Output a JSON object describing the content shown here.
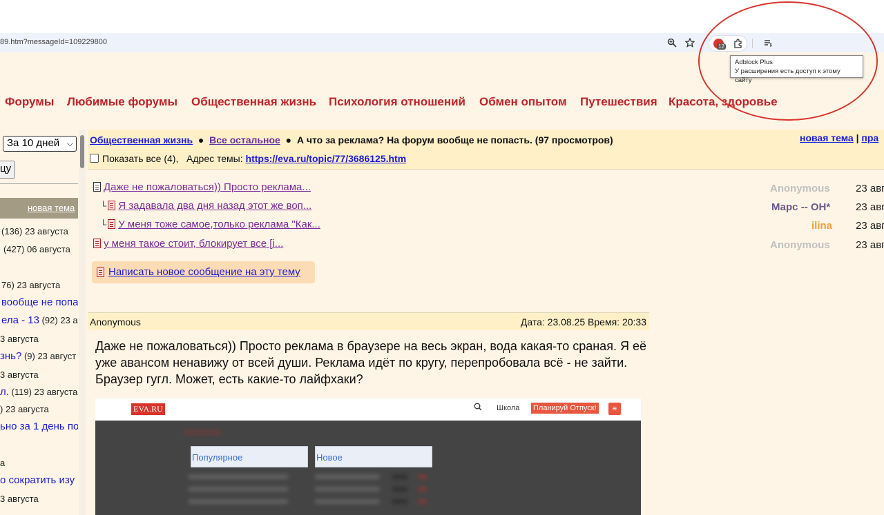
{
  "browser": {
    "url": "89.htm?messageId=109229800",
    "tooltip": {
      "title": "Adblock Plus",
      "text": "У расширения есть доступ к этому сайту"
    },
    "extension_badge": "12"
  },
  "nav": {
    "items": [
      "Форумы",
      "Любимые форумы",
      "Общественная жизнь",
      "Психология отношений",
      "Обмен опытом",
      "Путешествия",
      "Красота, здоровье"
    ]
  },
  "left": {
    "period_select": "За 10 дней",
    "button_label": "цу",
    "new_topic": "новая тема",
    "rows": [
      {
        "pre": "(136) 23 августа",
        "link": ""
      },
      {
        "pre": "(427) 06 августа",
        "link": ""
      },
      {
        "pre": "76) 23 августа",
        "link": ""
      },
      {
        "pre": "",
        "link": "вообще не попа"
      },
      {
        "pre": "(92) 23 а",
        "link": "ела - 13"
      },
      {
        "pre": "3 августа",
        "link": ""
      },
      {
        "pre": "(9) 23 август",
        "link": "знь?"
      },
      {
        "pre": "3 августа",
        "link": ""
      },
      {
        "pre": "(119) 23 августа",
        "link": "л."
      },
      {
        "pre": ") 23 августа",
        "link": ""
      },
      {
        "pre": "",
        "link": "ьно за 1 день по"
      },
      {
        "pre": "а",
        "link": ""
      },
      {
        "pre": "",
        "link": "о сократить изу"
      },
      {
        "pre": "3 августа",
        "link": ""
      }
    ]
  },
  "crumb": {
    "section": "Общественная жизнь",
    "subsection": "Все остальное",
    "topic": "А что за реклама? На форум вообще не попасть. (97 просмотров)",
    "show_all": "Показать все (4),",
    "address_label": "Адрес темы:",
    "address_url": "https://eva.ru/topic/77/3686125.htm",
    "new_topic": "новая тема",
    "divider": "|",
    "rules": "пра"
  },
  "messages": [
    {
      "title": "Даже не пожаловаться)) Просто реклама...",
      "author": "Anonymous",
      "author_color": "#c0c0c0",
      "date": "23 авг",
      "indent": false,
      "icon": "doc"
    },
    {
      "title": "Я задавала два дня назад этот же воп...",
      "author": "Марс -- ОН*",
      "author_color": "#6b5a8c",
      "date": "23 авг",
      "indent": true,
      "icon": "doc-red"
    },
    {
      "title": "У меня тоже самое,только реклама \"Как...",
      "author": "ilina",
      "author_color": "#f0a040",
      "date": "23 авг",
      "indent": true,
      "icon": "doc-red"
    },
    {
      "title": "у меня такое стоит, блокирует все [i...",
      "author": "Anonymous",
      "author_color": "#c0c0c0",
      "date": "23 авг",
      "indent": false,
      "icon": "doc-red"
    }
  ],
  "write_new": "Написать новое сообщение на эту тему",
  "post": {
    "author": "Anonymous",
    "datetime": "Дата: 23.08.25 Время: 20:33",
    "body": "Даже не пожаловаться)) Просто реклама в браузере на весь экран, вода какая-то сраная. Я её уже авансом ненавижу от всей души. Реклама идёт по кругу, перепробовала всё - не зайти. Браузер гугл. Может, есть какие-то лайфхаки?",
    "screenshot": {
      "logo": "EVA.RU",
      "school": "Школа",
      "plan": "Планируй Отпуск!",
      "tab_popular": "Популярное",
      "tab_new": "Новое"
    }
  }
}
